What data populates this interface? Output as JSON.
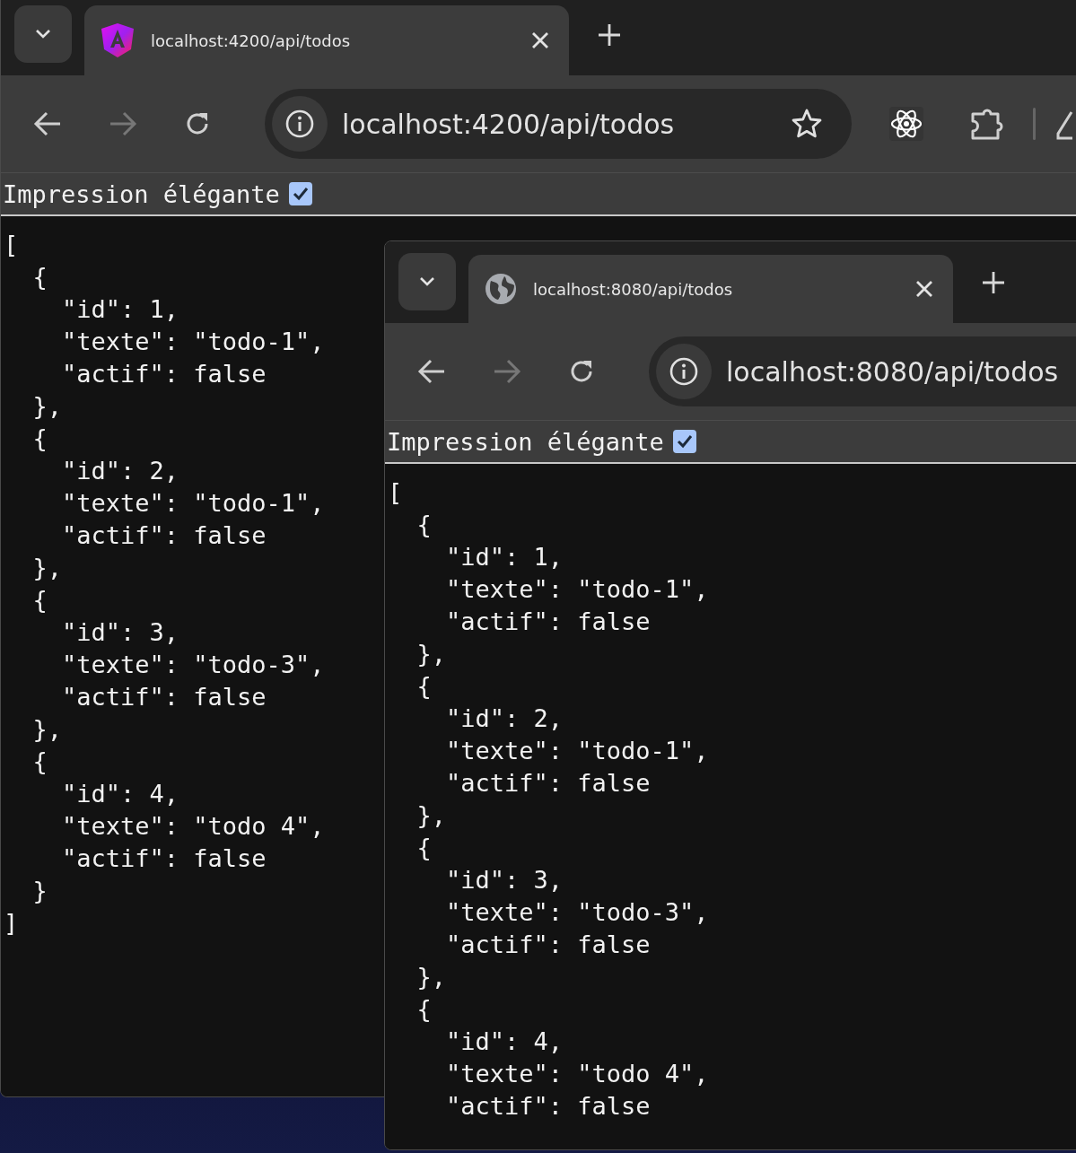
{
  "windows": [
    {
      "tab": {
        "title": "localhost:4200/api/todos",
        "kind": "angular"
      },
      "address": "localhost:4200/api/todos",
      "toolbar_actions": true,
      "pretty_print": {
        "label": "Impression élégante",
        "checked": true
      },
      "json_text": "[\n  {\n    \"id\": 1,\n    \"texte\": \"todo-1\",\n    \"actif\": false\n  },\n  {\n    \"id\": 2,\n    \"texte\": \"todo-1\",\n    \"actif\": false\n  },\n  {\n    \"id\": 3,\n    \"texte\": \"todo-3\",\n    \"actif\": false\n  },\n  {\n    \"id\": 4,\n    \"texte\": \"todo 4\",\n    \"actif\": false\n  }\n]"
    },
    {
      "tab": {
        "title": "localhost:8080/api/todos",
        "kind": "globe"
      },
      "address": "localhost:8080/api/todos",
      "toolbar_actions": false,
      "pretty_print": {
        "label": "Impression élégante",
        "checked": true
      },
      "json_text": "[\n  {\n    \"id\": 1,\n    \"texte\": \"todo-1\",\n    \"actif\": false\n  },\n  {\n    \"id\": 2,\n    \"texte\": \"todo-1\",\n    \"actif\": false\n  },\n  {\n    \"id\": 3,\n    \"texte\": \"todo-3\",\n    \"actif\": false\n  },\n  {\n    \"id\": 4,\n    \"texte\": \"todo 4\",\n    \"actif\": false"
    }
  ]
}
